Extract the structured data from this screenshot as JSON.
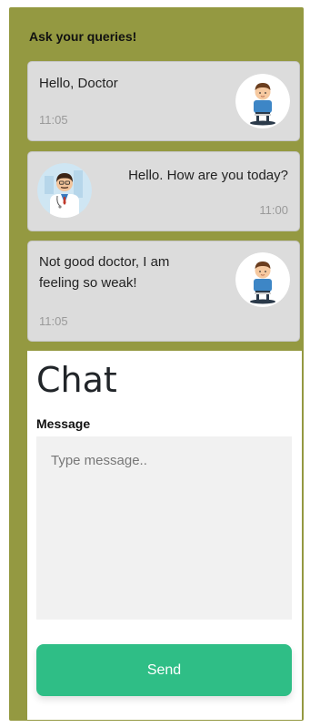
{
  "header": {
    "title": "Ask your queries!"
  },
  "messages": [
    {
      "text": "Hello, Doctor",
      "time": "11:05",
      "sender": "patient",
      "avatar_icon": "patient-avatar-icon"
    },
    {
      "text": "Hello. How are you today?",
      "time": "11:00",
      "sender": "doctor",
      "avatar_icon": "doctor-avatar-icon"
    },
    {
      "text": "Not good doctor, I am feeling so weak!",
      "time": "11:05",
      "sender": "patient",
      "avatar_icon": "patient-avatar-icon"
    }
  ],
  "chat": {
    "heading": "Chat",
    "message_label": "Message",
    "message_value": "",
    "message_placeholder": "Type message..",
    "send_label": "Send"
  },
  "colors": {
    "panel_background": "#949941",
    "bubble_background": "#dcdcdc",
    "send_button": "#2fbe86",
    "input_background": "#f1f1f1"
  }
}
